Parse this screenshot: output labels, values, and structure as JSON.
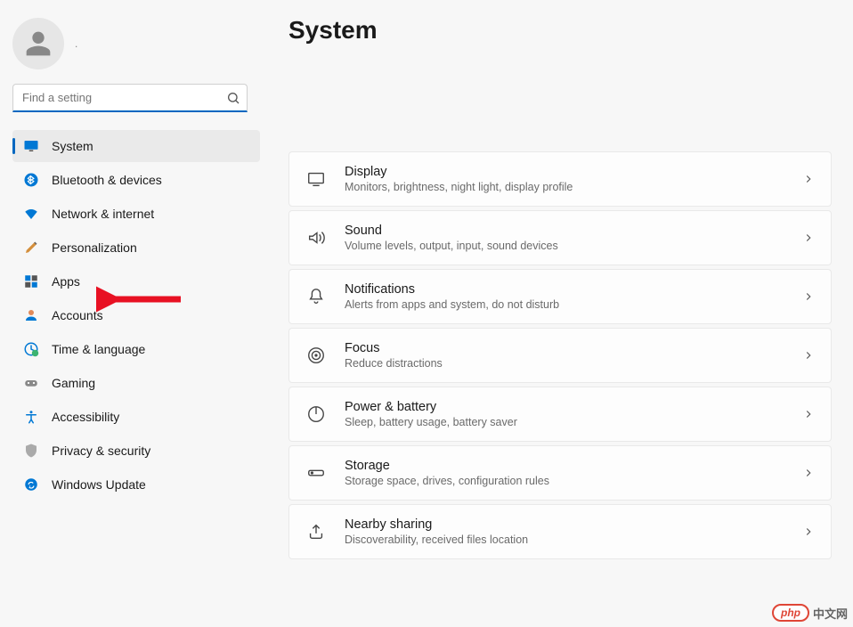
{
  "page_title": "System",
  "user": {
    "placeholder_dots": "."
  },
  "search": {
    "placeholder": "Find a setting"
  },
  "sidebar": {
    "items": [
      {
        "key": "system",
        "label": "System",
        "active": true
      },
      {
        "key": "bluetooth",
        "label": "Bluetooth & devices"
      },
      {
        "key": "network",
        "label": "Network & internet"
      },
      {
        "key": "personalization",
        "label": "Personalization"
      },
      {
        "key": "apps",
        "label": "Apps"
      },
      {
        "key": "accounts",
        "label": "Accounts"
      },
      {
        "key": "time",
        "label": "Time & language"
      },
      {
        "key": "gaming",
        "label": "Gaming"
      },
      {
        "key": "accessibility",
        "label": "Accessibility"
      },
      {
        "key": "privacy",
        "label": "Privacy & security"
      },
      {
        "key": "update",
        "label": "Windows Update"
      }
    ]
  },
  "cards": [
    {
      "key": "display",
      "title": "Display",
      "sub": "Monitors, brightness, night light, display profile"
    },
    {
      "key": "sound",
      "title": "Sound",
      "sub": "Volume levels, output, input, sound devices"
    },
    {
      "key": "notifications",
      "title": "Notifications",
      "sub": "Alerts from apps and system, do not disturb"
    },
    {
      "key": "focus",
      "title": "Focus",
      "sub": "Reduce distractions"
    },
    {
      "key": "power",
      "title": "Power & battery",
      "sub": "Sleep, battery usage, battery saver"
    },
    {
      "key": "storage",
      "title": "Storage",
      "sub": "Storage space, drives, configuration rules"
    },
    {
      "key": "nearby",
      "title": "Nearby sharing",
      "sub": "Discoverability, received files location"
    }
  ],
  "annotation": {
    "arrow_target": "apps"
  },
  "watermark": {
    "badge": "php",
    "text": "中文网"
  }
}
